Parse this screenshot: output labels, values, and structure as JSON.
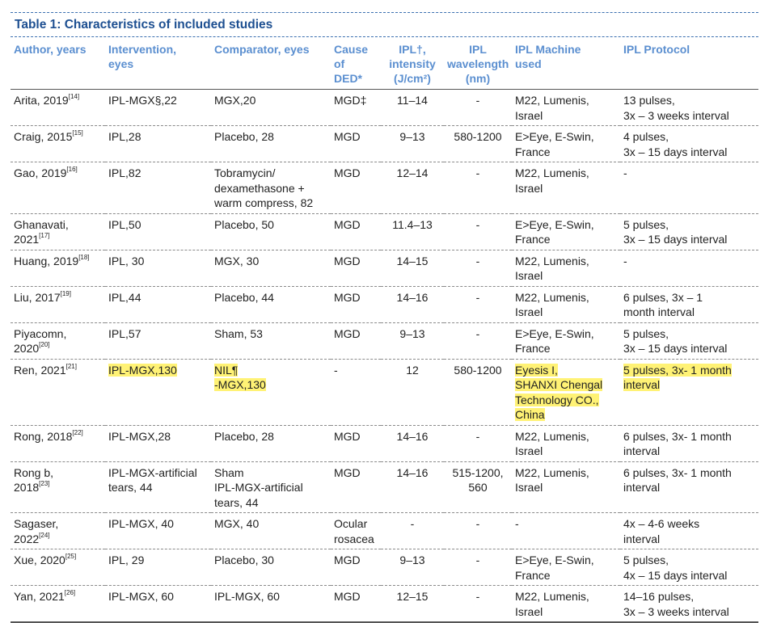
{
  "title": "Table 1: Characteristics of included studies",
  "colors": {
    "title": "#1d4f91",
    "header": "#5b8fd0",
    "highlight": "#fff275"
  },
  "headers": [
    [
      "Author, years"
    ],
    [
      "Intervention,",
      "eyes"
    ],
    [
      "Comparator, eyes"
    ],
    [
      "Cause",
      "of",
      "DED*"
    ],
    [
      "IPL†,",
      "intensity",
      "(J/cm²)"
    ],
    [
      "IPL",
      "wavelength",
      "(nm)"
    ],
    [
      "IPL Machine",
      "used"
    ],
    [
      "IPL Protocol"
    ]
  ],
  "rows": [
    {
      "author": [
        "Arita, 2019"
      ],
      "ref": "[14]",
      "intervention": [
        "IPL-MGX§,22"
      ],
      "comparator": [
        "MGX,20"
      ],
      "cause": [
        "MGD‡"
      ],
      "intensity": "11–14",
      "wavelength": [
        "-"
      ],
      "machine": [
        "M22, Lumenis,",
        "Israel"
      ],
      "protocol": [
        "13 pulses,",
        "3x – 3 weeks interval"
      ]
    },
    {
      "author": [
        "Craig, 2015"
      ],
      "ref": "[15]",
      "intervention": [
        "IPL,28"
      ],
      "comparator": [
        "Placebo, 28"
      ],
      "cause": [
        "MGD"
      ],
      "intensity": "9–13",
      "wavelength": [
        "580-1200"
      ],
      "machine": [
        "E>Eye, E-Swin,",
        "France"
      ],
      "protocol": [
        "4 pulses,",
        "3x – 15 days interval"
      ]
    },
    {
      "author": [
        "Gao, 2019"
      ],
      "ref": "[16]",
      "intervention": [
        "IPL,82"
      ],
      "comparator": [
        "Tobramycin/",
        "dexamethasone +",
        "warm compress, 82"
      ],
      "cause": [
        "MGD"
      ],
      "intensity": "12–14",
      "wavelength": [
        "-"
      ],
      "machine": [
        "M22, Lumenis,",
        "Israel"
      ],
      "protocol": [
        "-"
      ]
    },
    {
      "author": [
        "Ghanavati,",
        "2021"
      ],
      "ref": "[17]",
      "intervention": [
        "IPL,50"
      ],
      "comparator": [
        "Placebo, 50"
      ],
      "cause": [
        "MGD"
      ],
      "intensity": "11.4–13",
      "wavelength": [
        "-"
      ],
      "machine": [
        "E>Eye, E-Swin,",
        "France"
      ],
      "protocol": [
        "5 pulses,",
        "3x – 15 days interval"
      ]
    },
    {
      "author": [
        "Huang, 2019"
      ],
      "ref": "[18]",
      "intervention": [
        "IPL, 30"
      ],
      "comparator": [
        "MGX, 30"
      ],
      "cause": [
        "MGD"
      ],
      "intensity": "14–15",
      "wavelength": [
        "-"
      ],
      "machine": [
        "M22, Lumenis,",
        "Israel"
      ],
      "protocol": [
        "-"
      ]
    },
    {
      "author": [
        "Liu, 2017"
      ],
      "ref": "[19]",
      "intervention": [
        "IPL,44"
      ],
      "comparator": [
        "Placebo, 44"
      ],
      "cause": [
        "MGD"
      ],
      "intensity": "14–16",
      "wavelength": [
        "-"
      ],
      "machine": [
        "M22, Lumenis,",
        "Israel"
      ],
      "protocol": [
        "6 pulses, 3x – 1",
        "month interval"
      ]
    },
    {
      "author": [
        "Piyacomn,",
        "2020"
      ],
      "ref": "[20]",
      "intervention": [
        "IPL,57"
      ],
      "comparator": [
        "Sham, 53"
      ],
      "cause": [
        "MGD"
      ],
      "intensity": "9–13",
      "wavelength": [
        "-"
      ],
      "machine": [
        "E>Eye, E-Swin,",
        "France"
      ],
      "protocol": [
        "5 pulses,",
        "3x – 15 days interval"
      ]
    },
    {
      "author": [
        "Ren, 2021"
      ],
      "ref": "[21]",
      "intervention": [
        "IPL-MGX,130"
      ],
      "comparator": [
        "NIL¶",
        "-MGX,130"
      ],
      "cause": [
        "-"
      ],
      "intensity": "12",
      "wavelength": [
        "580-1200"
      ],
      "machine": [
        "Eyesis I,",
        "SHANXI Chengal",
        "Technology CO.,",
        "China"
      ],
      "protocol": [
        "5 pulses, 3x- 1 month",
        "interval"
      ],
      "highlight": true
    },
    {
      "author": [
        "Rong, 2018"
      ],
      "ref": "[22]",
      "intervention": [
        "IPL-MGX,28"
      ],
      "comparator": [
        "Placebo, 28"
      ],
      "cause": [
        "MGD"
      ],
      "intensity": "14–16",
      "wavelength": [
        "-"
      ],
      "machine": [
        "M22, Lumenis,",
        "Israel"
      ],
      "protocol": [
        "6 pulses, 3x- 1 month",
        "interval"
      ]
    },
    {
      "author": [
        "Rong b,",
        "2018"
      ],
      "ref": "[23]",
      "intervention": [
        "IPL-MGX-artificial",
        "tears, 44"
      ],
      "comparator": [
        "Sham",
        "IPL-MGX-artificial",
        "tears, 44"
      ],
      "cause": [
        "MGD"
      ],
      "intensity": "14–16",
      "wavelength": [
        "515-1200,",
        "560"
      ],
      "machine": [
        "M22, Lumenis,",
        "Israel"
      ],
      "protocol": [
        "6 pulses, 3x- 1 month",
        "interval"
      ]
    },
    {
      "author": [
        "Sagaser,",
        "2022"
      ],
      "ref": "[24]",
      "intervention": [
        "IPL-MGX, 40"
      ],
      "comparator": [
        "MGX, 40"
      ],
      "cause": [
        "Ocular",
        "rosacea"
      ],
      "intensity": "-",
      "wavelength": [
        "-"
      ],
      "machine": [
        "-"
      ],
      "protocol": [
        "4x – 4-6 weeks",
        "interval"
      ]
    },
    {
      "author": [
        "Xue, 2020"
      ],
      "ref": "[25]",
      "intervention": [
        "IPL, 29"
      ],
      "comparator": [
        "Placebo, 30"
      ],
      "cause": [
        "MGD"
      ],
      "intensity": "9–13",
      "wavelength": [
        "-"
      ],
      "machine": [
        "E>Eye, E-Swin,",
        "France"
      ],
      "protocol": [
        "5 pulses,",
        "4x – 15 days interval"
      ]
    },
    {
      "author": [
        "Yan, 2021"
      ],
      "ref": "[26]",
      "intervention": [
        "IPL-MGX, 60"
      ],
      "comparator": [
        "IPL-MGX, 60"
      ],
      "cause": [
        "MGD"
      ],
      "intensity": "12–15",
      "wavelength": [
        "-"
      ],
      "machine": [
        "M22, Lumenis,",
        "Israel"
      ],
      "protocol": [
        "14–16 pulses,",
        "3x – 3 weeks interval"
      ]
    }
  ]
}
